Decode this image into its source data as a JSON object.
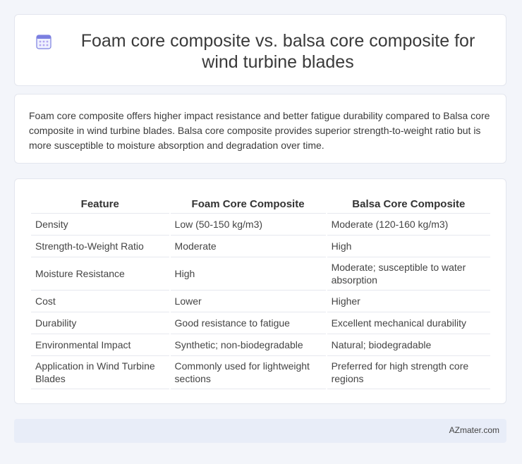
{
  "header": {
    "title": "Foam core composite vs. balsa core composite for wind turbine blades",
    "icon": "calendar-icon",
    "icon_color": "#7b7fe0"
  },
  "summary": {
    "text": "Foam core composite offers higher impact resistance and better fatigue durability compared to Balsa core composite in wind turbine blades. Balsa core composite provides superior strength-to-weight ratio but is more susceptible to moisture absorption and degradation over time."
  },
  "table": {
    "headers": [
      "Feature",
      "Foam Core Composite",
      "Balsa Core Composite"
    ],
    "rows": [
      [
        "Density",
        "Low (50-150 kg/m3)",
        "Moderate (120-160 kg/m3)"
      ],
      [
        "Strength-to-Weight Ratio",
        "Moderate",
        "High"
      ],
      [
        "Moisture Resistance",
        "High",
        "Moderate; susceptible to water absorption"
      ],
      [
        "Cost",
        "Lower",
        "Higher"
      ],
      [
        "Durability",
        "Good resistance to fatigue",
        "Excellent mechanical durability"
      ],
      [
        "Environmental Impact",
        "Synthetic; non-biodegradable",
        "Natural; biodegradable"
      ],
      [
        "Application in Wind Turbine Blades",
        "Commonly used for lightweight sections",
        "Preferred for high strength core regions"
      ]
    ]
  },
  "footer": {
    "brand": "AZmater.com"
  }
}
